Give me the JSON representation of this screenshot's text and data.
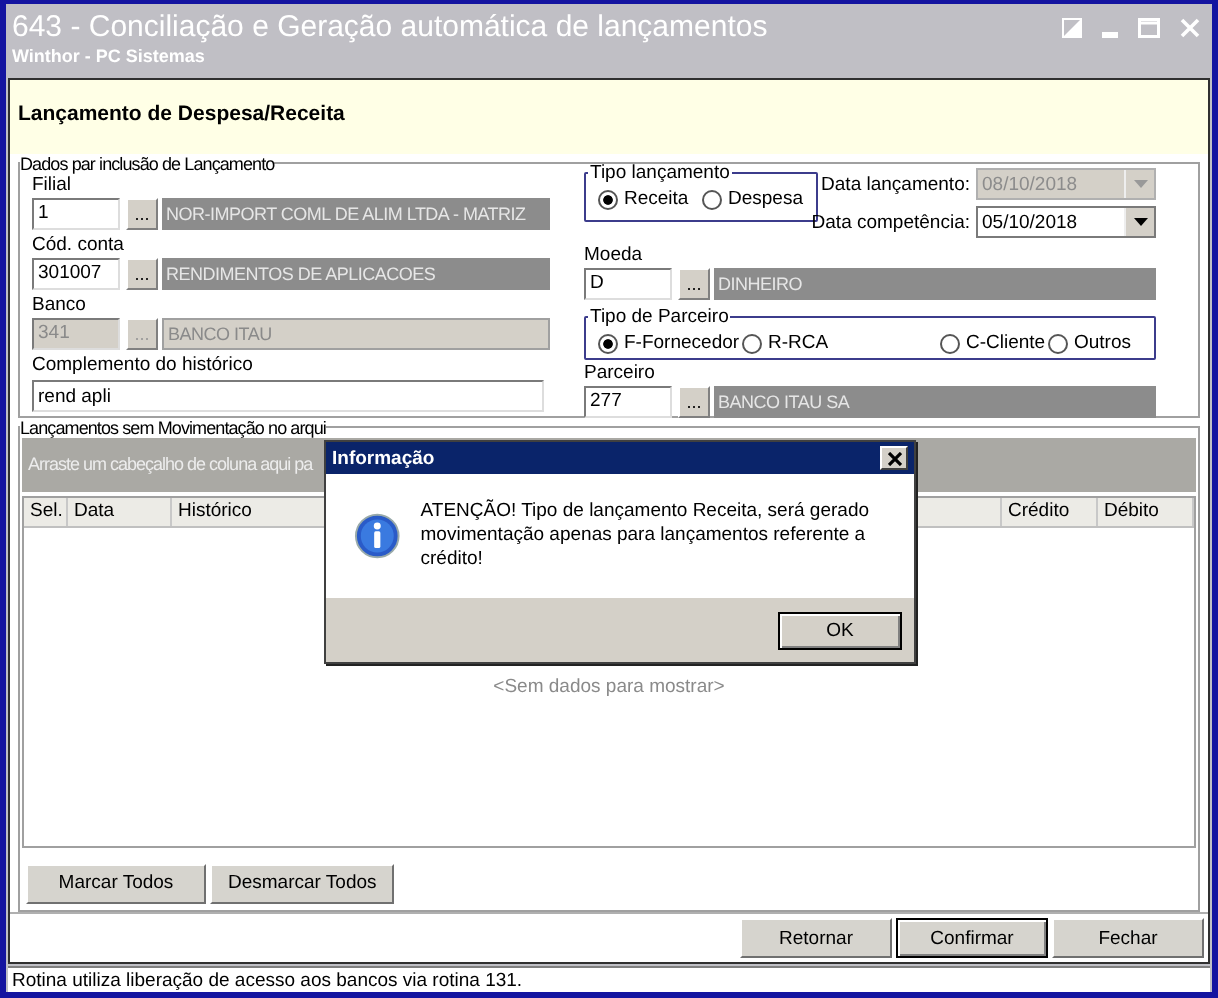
{
  "window": {
    "title": "643 - Conciliação e Geração automática de lançamentos",
    "subtitle": "Winthor - PC Sistemas"
  },
  "header": {
    "title": "Lançamento de Despesa/Receita"
  },
  "form": {
    "legend": "Dados par inclusão de Lançamento",
    "lookups": [
      {
        "label": "Filial",
        "code": "1",
        "button": "...",
        "description": "NOR-IMPORT COML DE ALIM LTDA - MATRIZ",
        "disabled": false
      },
      {
        "label": "Cód. conta",
        "code": "301007",
        "button": "...",
        "description": "RENDIMENTOS DE APLICACOES",
        "disabled": false
      },
      {
        "label": "Banco",
        "code": "341",
        "button": "...",
        "description": "BANCO ITAU",
        "disabled": true
      }
    ],
    "complemento": {
      "label": "Complemento do histórico",
      "value": "rend apli"
    },
    "tipo_lancamento": {
      "legend": "Tipo lançamento",
      "options": [
        {
          "label": "Receita",
          "selected": true
        },
        {
          "label": "Despesa",
          "selected": false
        }
      ]
    },
    "dates": [
      {
        "label": "Data lançamento:",
        "value": "08/10/2018",
        "disabled": true
      },
      {
        "label": "Data competência:",
        "value": "05/10/2018",
        "disabled": false
      }
    ],
    "moeda": {
      "label": "Moeda",
      "code": "D",
      "button": "...",
      "description": "DINHEIRO",
      "disabled": false
    },
    "tipo_parceiro": {
      "legend": "Tipo de Parceiro",
      "options": [
        {
          "label": "F-Fornecedor",
          "selected": true
        },
        {
          "label": "R-RCA",
          "selected": false
        },
        {
          "label": "C-Cliente",
          "selected": false
        },
        {
          "label": "Outros",
          "selected": false
        }
      ]
    },
    "parceiro": {
      "label": "Parceiro",
      "code": "277",
      "button": "...",
      "description": "BANCO ITAU SA",
      "disabled": false
    }
  },
  "grid": {
    "legend": "Lançamentos sem Movimentação no arqui",
    "group_hint": "Arraste um cabeçalho de coluna aqui pa",
    "columns": [
      {
        "label": "Sel."
      },
      {
        "label": "Data"
      },
      {
        "label": "Histórico"
      },
      {
        "label": "Crédito"
      },
      {
        "label": "Débito"
      }
    ],
    "empty_text": "<Sem dados para mostrar>",
    "buttons": [
      "Marcar Todos",
      "Desmarcar Todos"
    ]
  },
  "actions": [
    {
      "label": "Retornar",
      "default": false
    },
    {
      "label": "Confirmar",
      "default": true
    },
    {
      "label": "Fechar",
      "default": false
    }
  ],
  "status_bar": "Rotina utiliza liberação de acesso aos bancos via rotina 131.",
  "dialog": {
    "title": "Informação",
    "message": "ATENÇÃO! Tipo de lançamento Receita, será gerado movimentação apenas para lançamentos referente a crédito!",
    "button": "OK"
  }
}
